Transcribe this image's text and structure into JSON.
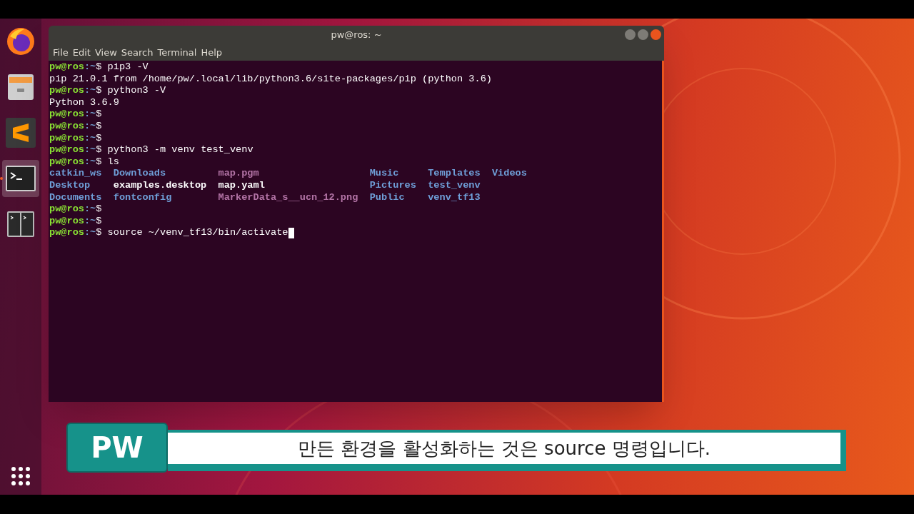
{
  "dock": {
    "items": [
      {
        "kind": "firefox",
        "selected": false
      },
      {
        "kind": "files",
        "selected": false
      },
      {
        "kind": "sublime",
        "selected": false
      },
      {
        "kind": "terminal",
        "selected": true
      },
      {
        "kind": "split-terminal",
        "selected": false
      }
    ]
  },
  "window": {
    "title": "pw@ros: ~",
    "menu": [
      "File",
      "Edit",
      "View",
      "Search",
      "Terminal",
      "Help"
    ]
  },
  "terminal": {
    "lines": [
      {
        "kind": "prompt",
        "user": "pw@ros",
        "path": ":~",
        "symbol": "$",
        "command": " pip3 -V"
      },
      {
        "kind": "output",
        "text": "pip 21.0.1 from /home/pw/.local/lib/python3.6/site-packages/pip (python 3.6)"
      },
      {
        "kind": "prompt",
        "user": "pw@ros",
        "path": ":~",
        "symbol": "$",
        "command": " python3 -V"
      },
      {
        "kind": "output",
        "text": "Python 3.6.9"
      },
      {
        "kind": "prompt",
        "user": "pw@ros",
        "path": ":~",
        "symbol": "$"
      },
      {
        "kind": "prompt",
        "user": "pw@ros",
        "path": ":~",
        "symbol": "$"
      },
      {
        "kind": "prompt",
        "user": "pw@ros",
        "path": ":~",
        "symbol": "$"
      },
      {
        "kind": "prompt",
        "user": "pw@ros",
        "path": ":~",
        "symbol": "$",
        "command": " python3 -m venv test_venv"
      },
      {
        "kind": "prompt",
        "user": "pw@ros",
        "path": ":~",
        "symbol": "$",
        "command": " ls"
      },
      {
        "kind": "listing",
        "cells": [
          {
            "text": "catkin_ws",
            "color": "#6f9fd8"
          },
          {
            "text": "Downloads",
            "color": "#6f9fd8"
          },
          {
            "text": "map.pgm",
            "color": "#b374a6"
          },
          {
            "text": "Music",
            "color": "#6f9fd8"
          },
          {
            "text": "Templates",
            "color": "#6f9fd8"
          },
          {
            "text": "Videos",
            "color": "#6f9fd8"
          }
        ]
      },
      {
        "kind": "listing",
        "cells": [
          {
            "text": "Desktop",
            "color": "#6f9fd8"
          },
          {
            "text": "examples.desktop",
            "color": "#ffffff"
          },
          {
            "text": "map.yaml",
            "color": "#ffffff"
          },
          {
            "text": "Pictures",
            "color": "#6f9fd8"
          },
          {
            "text": "test_venv",
            "color": "#6f9fd8"
          }
        ]
      },
      {
        "kind": "listing",
        "cells": [
          {
            "text": "Documents",
            "color": "#6f9fd8"
          },
          {
            "text": "fontconfig",
            "color": "#6f9fd8"
          },
          {
            "text": "MarkerData_s__ucn_12.png",
            "color": "#b374a6"
          },
          {
            "text": "Public",
            "color": "#6f9fd8"
          },
          {
            "text": "venv_tf13",
            "color": "#6f9fd8"
          }
        ]
      },
      {
        "kind": "prompt",
        "user": "pw@ros",
        "path": ":~",
        "symbol": "$"
      },
      {
        "kind": "prompt",
        "user": "pw@ros",
        "path": ":~",
        "symbol": "$"
      },
      {
        "kind": "prompt",
        "user": "pw@ros",
        "path": ":~",
        "symbol": "$",
        "command": " source ~/venv_tf13/bin/activate",
        "cursor": true
      }
    ]
  },
  "subtitle": {
    "speaker": "PW",
    "text": "만든 환경을 활성화하는 것은 source 명령입니다."
  }
}
